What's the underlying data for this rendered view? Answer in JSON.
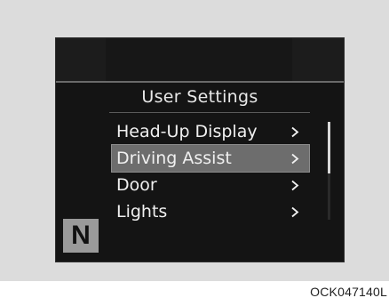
{
  "screen": {
    "title": "User Settings",
    "gear": "N",
    "menu": {
      "items": [
        {
          "label": "Head-Up Display",
          "icon": "chevron-right-icon",
          "selected": false
        },
        {
          "label": "Driving Assist",
          "icon": "chevron-right-icon",
          "selected": true
        },
        {
          "label": "Door",
          "icon": "chevron-right-icon",
          "selected": false
        },
        {
          "label": "Lights",
          "icon": "chevron-right-icon",
          "selected": false
        }
      ]
    },
    "scroll_position": 0
  },
  "figure_code": "OCK047140L",
  "colors": {
    "display_background": "#141414",
    "selected_row": "#6d6d6d",
    "gear_indicator": "#9a9a9a",
    "text": "#f0f0f0"
  }
}
